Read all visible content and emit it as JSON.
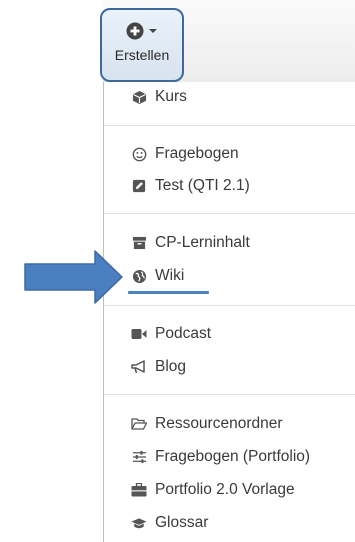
{
  "create": {
    "label": "Erstellen",
    "icon": "plus-circle-icon",
    "caret": "chevron-down-icon"
  },
  "menu": {
    "items": [
      {
        "label": "Kurs",
        "icon": "cube-icon"
      },
      {
        "label": "Fragebogen",
        "icon": "smiley-icon"
      },
      {
        "label": "Test (QTI 2.1)",
        "icon": "pencil-square-icon"
      },
      {
        "label": "CP-Lerninhalt",
        "icon": "archive-icon"
      },
      {
        "label": "Wiki",
        "icon": "globe-icon"
      },
      {
        "label": "Podcast",
        "icon": "video-camera-icon"
      },
      {
        "label": "Blog",
        "icon": "bullhorn-icon"
      },
      {
        "label": "Ressourcenordner",
        "icon": "folder-open-icon"
      },
      {
        "label": "Fragebogen (Portfolio)",
        "icon": "sliders-icon"
      },
      {
        "label": "Portfolio 2.0 Vorlage",
        "icon": "briefcase-icon"
      },
      {
        "label": "Glossar",
        "icon": "graduation-cap-icon"
      }
    ]
  },
  "colors": {
    "highlight": "#4a83c1",
    "button_border": "#3d6a9b"
  }
}
